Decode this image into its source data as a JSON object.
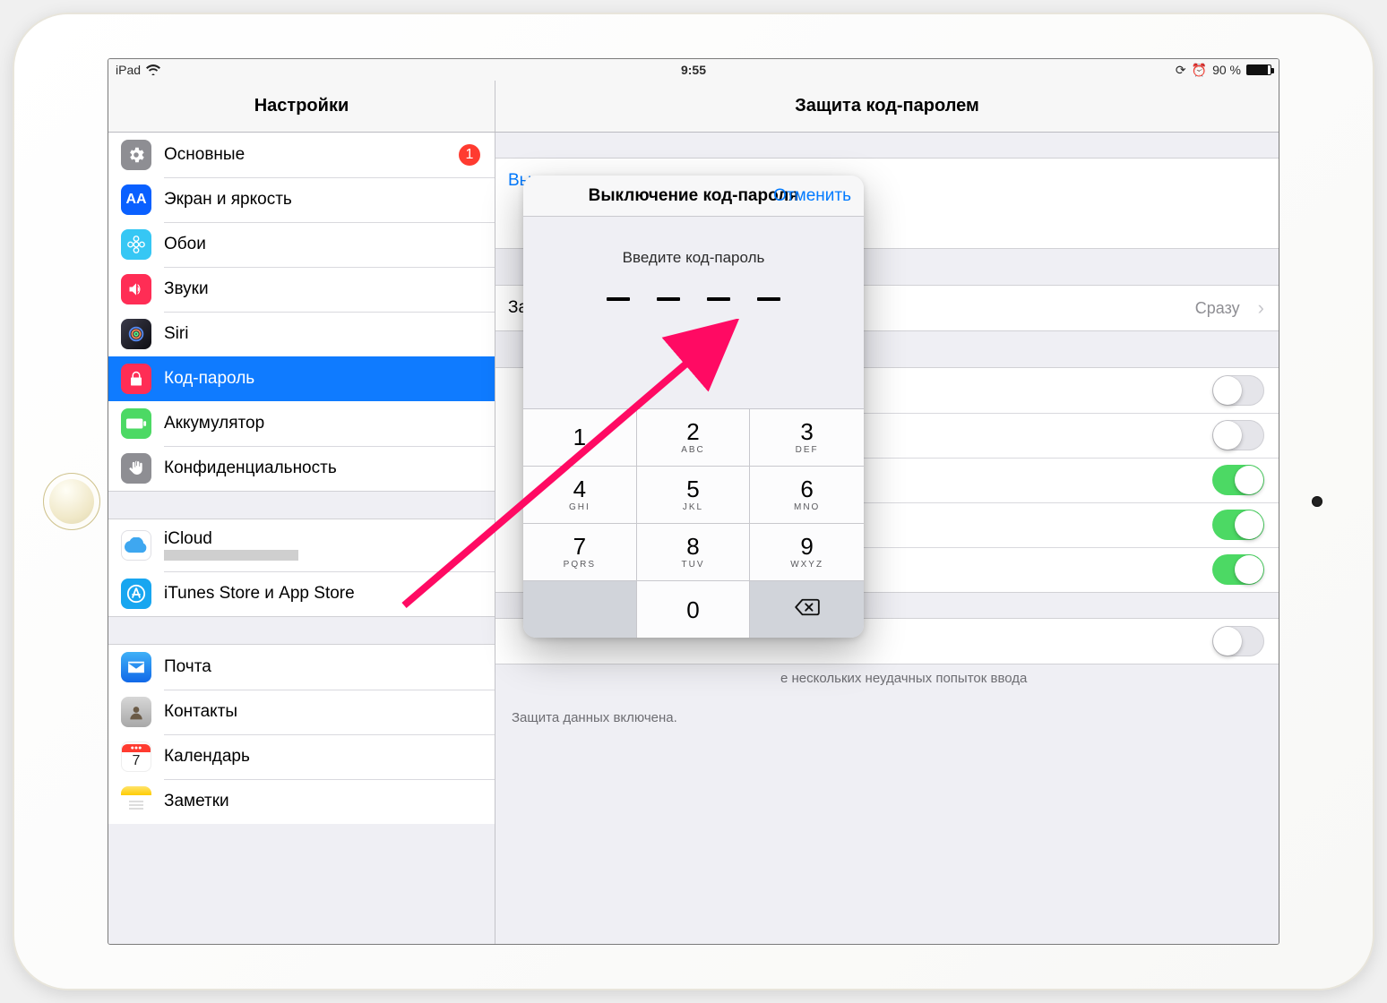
{
  "status": {
    "carrier": "iPad",
    "time": "9:55",
    "battery_text": "90 %",
    "battery_level": 90
  },
  "titles": {
    "left": "Настройки",
    "right": "Защита код-паролем"
  },
  "sidebar": {
    "groups": [
      {
        "items": [
          {
            "icon": "gear-icon",
            "bg": "#8e8e93",
            "label": "Основные",
            "badge": "1"
          },
          {
            "icon": "aa-icon",
            "bg": "#0a60ff",
            "label": "Экран и яркость"
          },
          {
            "icon": "flower-icon",
            "bg": "#36c7f4",
            "label": "Обои"
          },
          {
            "icon": "speaker-icon",
            "bg": "#ff2d55",
            "label": "Звуки"
          },
          {
            "icon": "siri-icon",
            "bg": "#1b1b1d",
            "label": "Siri"
          },
          {
            "icon": "lock-icon",
            "bg": "#ff2d55",
            "label": "Код-пароль",
            "selected": true
          },
          {
            "icon": "battery-icon",
            "bg": "#4cd964",
            "label": "Аккумулятор"
          },
          {
            "icon": "hand-icon",
            "bg": "#8e8e93",
            "label": "Конфиденциальность"
          }
        ]
      },
      {
        "items": [
          {
            "icon": "icloud-icon",
            "bg": "#ffffff",
            "label": "iCloud",
            "subtitle": " "
          },
          {
            "icon": "appstore-icon",
            "bg": "#18a6f0",
            "label": "iTunes Store и App Store"
          }
        ]
      },
      {
        "items": [
          {
            "icon": "mail-icon",
            "bg": "#1c8ef3",
            "label": "Почта"
          },
          {
            "icon": "contacts-icon",
            "bg": "#bfbfbf",
            "label": "Контакты"
          },
          {
            "icon": "calendar-icon",
            "bg": "#ffffff",
            "label": "Календарь"
          },
          {
            "icon": "notes-icon",
            "bg": "#ffcc00",
            "label": "Заметки"
          }
        ]
      }
    ]
  },
  "detail": {
    "disable_link": "Выключить код-пароль",
    "require_label": "Запрашивать",
    "require_value": "Сразу",
    "switches": [
      {
        "label": "",
        "on": false
      },
      {
        "label": "",
        "on": false
      },
      {
        "label": "",
        "on": true
      },
      {
        "label": "",
        "on": true
      },
      {
        "label": "",
        "on": true
      }
    ],
    "erase_switch": {
      "label": "",
      "on": false
    },
    "footer1_partial": "е нескольких неудачных попыток ввода ",
    "footer2": "Защита данных включена."
  },
  "keypad": {
    "title": "Выключение код-пароля",
    "cancel": "Отменить",
    "prompt": "Введите код-пароль",
    "keys": [
      {
        "d": "1",
        "l": ""
      },
      {
        "d": "2",
        "l": "ABC"
      },
      {
        "d": "3",
        "l": "DEF"
      },
      {
        "d": "4",
        "l": "GHI"
      },
      {
        "d": "5",
        "l": "JKL"
      },
      {
        "d": "6",
        "l": "MNO"
      },
      {
        "d": "7",
        "l": "PQRS"
      },
      {
        "d": "8",
        "l": "TUV"
      },
      {
        "d": "9",
        "l": "WXYZ"
      }
    ],
    "zero": "0"
  }
}
